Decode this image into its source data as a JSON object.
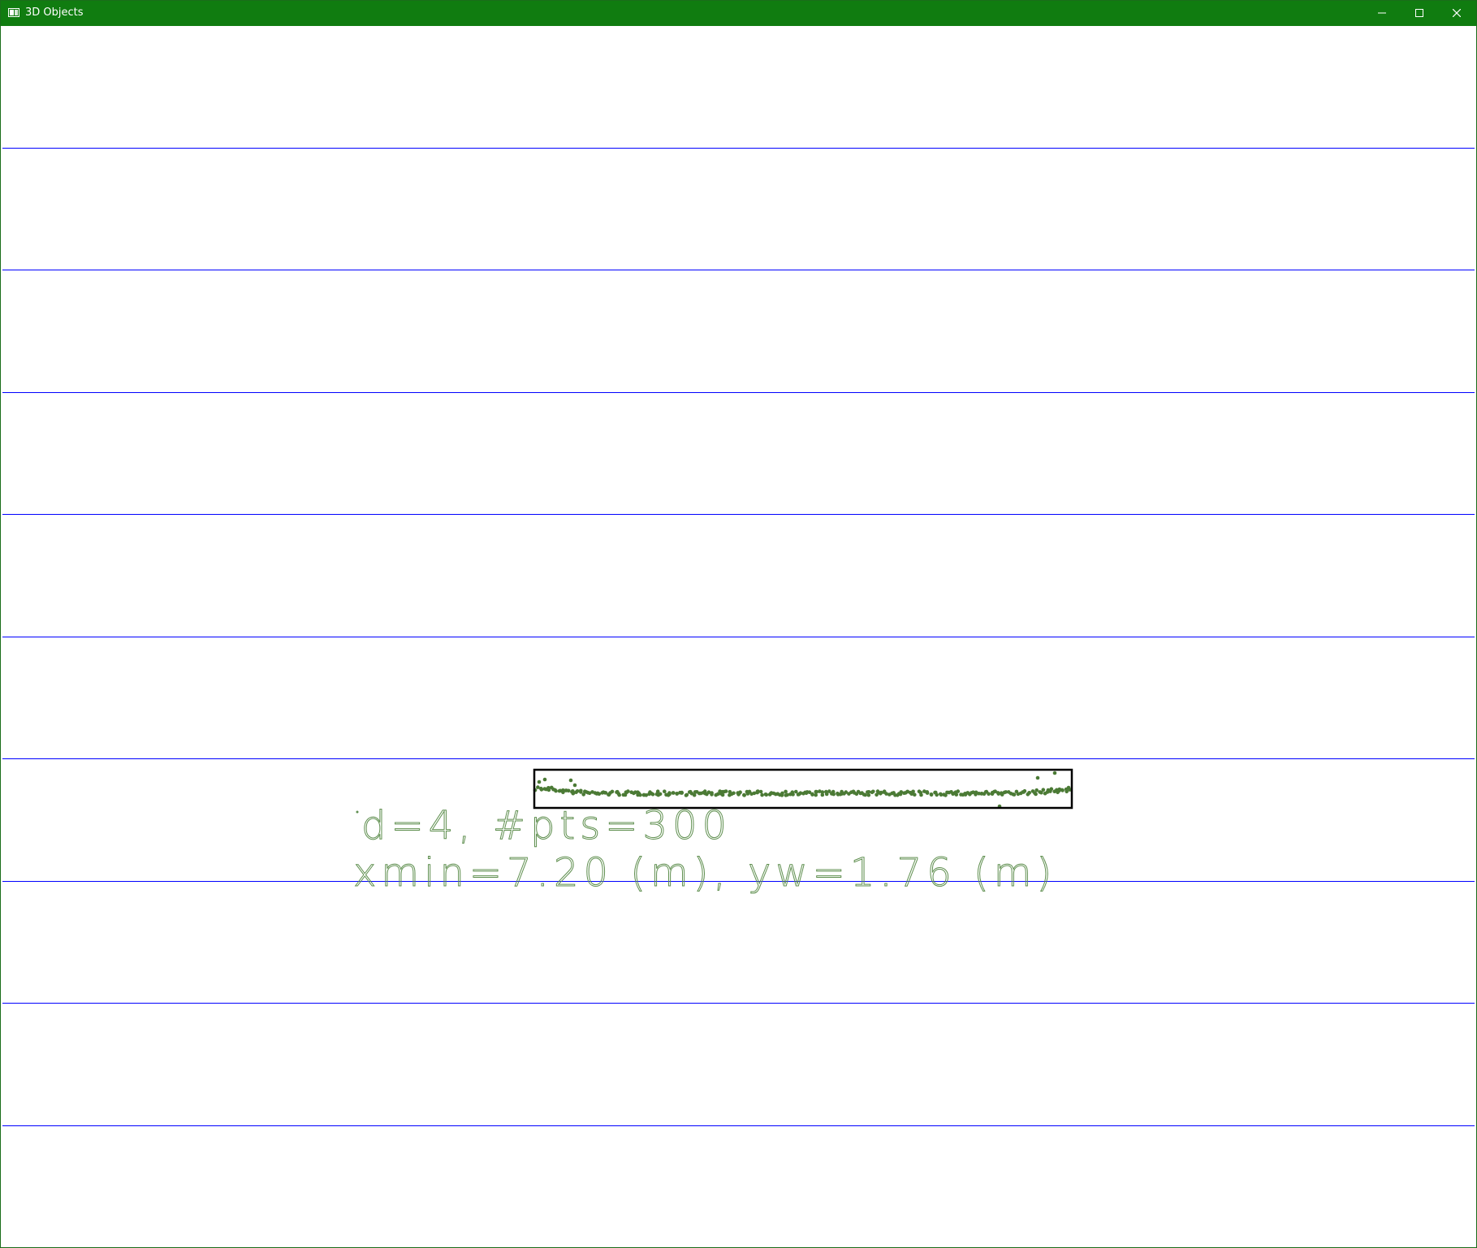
{
  "window": {
    "title": "3D Objects",
    "controls": {
      "minimize_icon": "minimize-icon",
      "maximize_icon": "maximize-icon",
      "close_icon": "close-icon"
    },
    "titlebar_color": "#107c10"
  },
  "view": {
    "lane_line_color": "#0000ff",
    "point_color": "#4b7a35",
    "box_color": "#000000",
    "text_color": "#5f8f4f",
    "labels": {
      "line1": "d=4, #pts=300",
      "line2": "xmin=7.20 (m), yw=1.76 (m)"
    }
  }
}
